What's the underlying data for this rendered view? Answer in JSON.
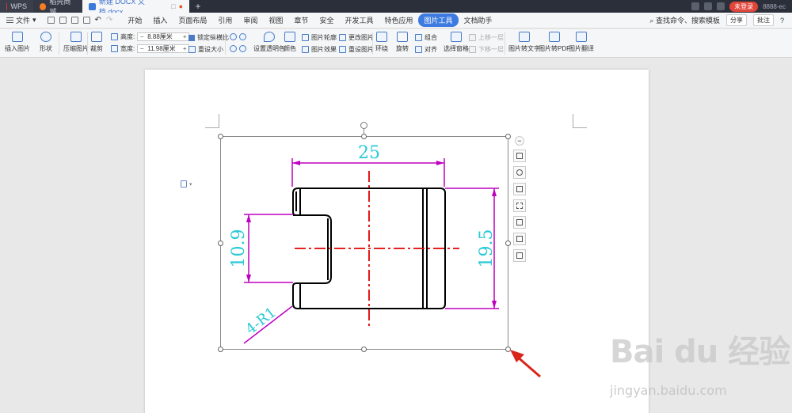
{
  "titlebar": {
    "tabs": [
      {
        "label": "WPS"
      },
      {
        "label": "稻壳商城"
      },
      {
        "label": "新建 DOCX 文档.docx"
      }
    ],
    "login_label": "未登录",
    "user_label": "8888-ec"
  },
  "menubar": {
    "file_label": "文件",
    "items": [
      "开始",
      "插入",
      "页面布局",
      "引用",
      "审阅",
      "视图",
      "章节",
      "安全",
      "开发工具",
      "特色应用",
      "图片工具",
      "文档助手"
    ],
    "active_index": 10,
    "search_label": "查找命令、搜索模板",
    "share_label": "分享",
    "comment_label": "批注",
    "help_label": "?"
  },
  "ribbon": {
    "insert_picture": "插入图片",
    "shape": "形状",
    "compress": "压缩图片",
    "crop": "裁剪",
    "height_label": "高度:",
    "height_value": "8.88厘米",
    "width_label": "宽度:",
    "width_value": "11.98厘米",
    "lock_ratio": "锁定纵横比",
    "reset_size": "重设大小",
    "set_transparent": "设置透明色",
    "color": "颜色",
    "picture_outline": "图片轮廓",
    "picture_effect": "图片效果",
    "change_picture": "更改图片",
    "reset_picture": "重设图片",
    "wrap": "环绕",
    "rotate": "旋转",
    "group": "组合",
    "align": "对齐",
    "select_pane": "选择窗格",
    "bring_forward": "上移一层",
    "send_backward": "下移一层",
    "pic_to_text": "图片转文字",
    "pic_to_pdf": "图片转PDF",
    "pic_translate": "图片翻译"
  },
  "drawing": {
    "dim_width": "25",
    "dim_slot": "10.9",
    "dim_height": "19.5",
    "dim_radius": "4-R1"
  },
  "watermark": {
    "main": "Bai du 经验",
    "sub": "jingyan.baidu.com"
  },
  "colors": {
    "accent": "#3d7be0",
    "dimension_line": "#c000c0",
    "dimension_text": "#2ac9d6",
    "center_line": "#e00000",
    "arrow": "#d9251c"
  }
}
